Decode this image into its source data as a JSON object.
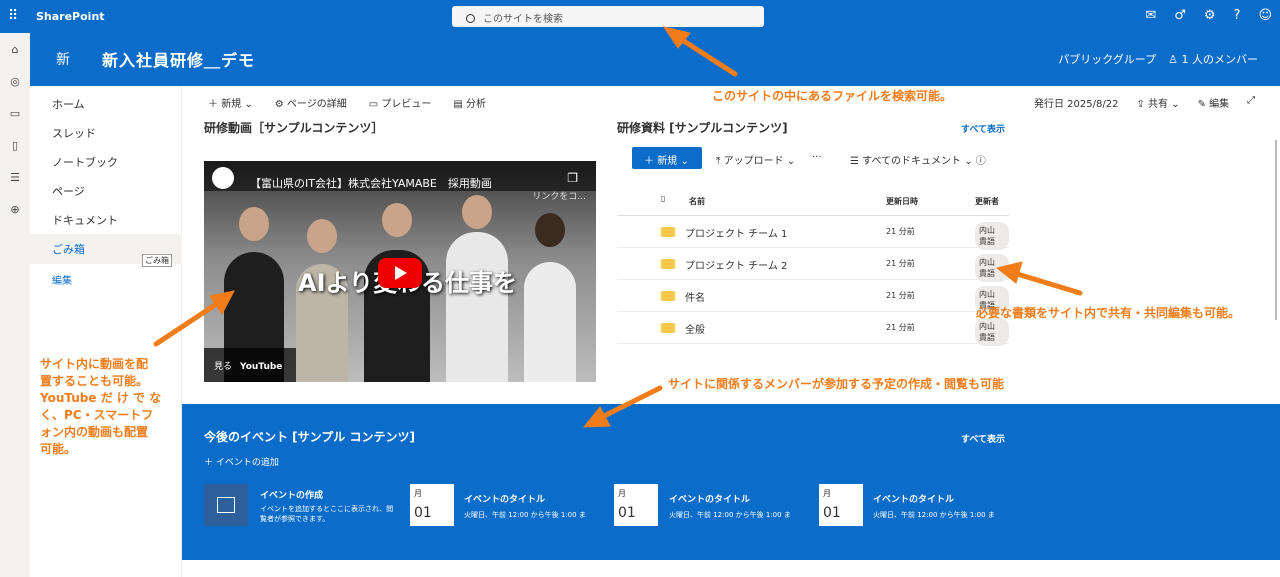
{
  "topbar": {
    "brand": "SharePoint",
    "search_placeholder": "このサイトを検索"
  },
  "header": {
    "site_logo": "新",
    "site_title": "新入社員研修＿デモ",
    "group": "パブリックグループ",
    "members": "1 人のメンバー"
  },
  "nav": [
    "ホーム",
    "スレッド",
    "ノートブック",
    "ページ",
    "ドキュメント",
    "ごみ箱"
  ],
  "nav_edit": "編集",
  "nav_tooltip": "ごみ箱",
  "cmd": {
    "new": "新規",
    "details": "ページの詳細",
    "preview": "プレビュー",
    "analytics": "分析",
    "published": "発行日 2025/8/22",
    "share": "共有",
    "edit": "編集"
  },
  "video_section": {
    "title": "研修動画［サンプルコンテンツ］",
    "video_title": "【富山県のIT会社】株式会社YAMABE　採用動画",
    "copy_link": "リンクをコ...",
    "overlay": "AIより変わる仕事を",
    "watch": "見る",
    "youtube": "YouTube"
  },
  "docs": {
    "title": "研修資料 [サンプルコンテンツ]",
    "see_all": "すべて表示",
    "new": "新規",
    "upload": "アップロード",
    "more": "···",
    "view": "すべてのドキュメント",
    "col_name": "名前",
    "col_modified": "更新日時",
    "col_by": "更新者",
    "rows": [
      {
        "name": "プロジェクト チーム 1",
        "time": "21 分前",
        "by": "内山 貴語"
      },
      {
        "name": "プロジェクト チーム 2",
        "time": "21 分前",
        "by": "内山 貴語"
      },
      {
        "name": "件名",
        "time": "21 分前",
        "by": "内山 貴語"
      },
      {
        "name": "全般",
        "time": "21 分前",
        "by": "内山 貴語"
      }
    ]
  },
  "events": {
    "title": "今後のイベント [サンプル コンテンツ]",
    "see_all": "すべて表示",
    "add": "イベントの追加",
    "create_title": "イベントの作成",
    "create_desc": "イベントを追加するとここに表示され、閲覧者が参照できます。",
    "items": [
      {
        "month": "月",
        "day": "01",
        "name": "イベントのタイトル",
        "when": "火曜日、午前 12:00 から午後 1:00 ま"
      },
      {
        "month": "月",
        "day": "01",
        "name": "イベントのタイトル",
        "when": "火曜日、午前 12:00 から午後 1:00 ま"
      },
      {
        "month": "月",
        "day": "01",
        "name": "イベントのタイトル",
        "when": "火曜日、午前 12:00 から午後 1:00 ま"
      }
    ]
  },
  "annotations": {
    "search": "このサイトの中にあるファイルを検索可能。",
    "docs": "必要な書類をサイト内で共有・共同編集も可能。",
    "events": "サイトに関係するメンバーが参加する予定の作成・閲覧も可能",
    "video": [
      "サイト内に動画を配",
      "置することも可能。",
      "YouTube だ け で な",
      "く、PC・スマートフ",
      "ォン内の動画も配置",
      "可能。"
    ]
  },
  "colors": {
    "brand": "#0b6cc9",
    "annotation": "#f07d1a"
  },
  "icons": [
    "waffle-icon",
    "search-icon",
    "megaphone-icon",
    "share-icon",
    "gear-icon",
    "help-icon",
    "person-icon",
    "folder-icon",
    "calendar-icon",
    "play-icon"
  ]
}
